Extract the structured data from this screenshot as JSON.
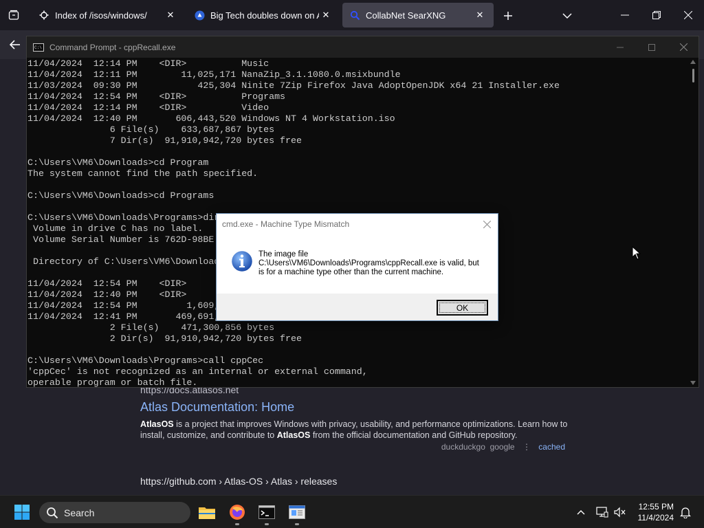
{
  "browser": {
    "tabs": [
      {
        "title": "Index of /isos/windows/",
        "active": false
      },
      {
        "title": "Big Tech doubles down on AI, S",
        "active": false
      },
      {
        "title": "CollabNet SearXNG",
        "active": true
      }
    ]
  },
  "results": [
    {
      "url": "https://docs.atlasos.net",
      "title": "Atlas Documentation: Home",
      "desc_part1_bold": "AtlasOS",
      "desc_part2": " is a project that improves Windows with privacy, usability, and performance optimizations. Learn how to install, customize, and contribute to ",
      "desc_part3_bold": "AtlasOS",
      "desc_part4": " from the official documentation and GitHub repository.",
      "engines": "duckduckgo  google",
      "sep": "⋮",
      "cached": "cached"
    },
    {
      "url": "https://github.com  › Atlas-OS › Atlas › releases"
    }
  ],
  "cmd": {
    "title": "Command Prompt - cppRecall.exe",
    "lines": [
      "11/04/2024  12:14 PM    <DIR>          Music",
      "11/04/2024  12:11 PM        11,025,171 NanaZip_3.1.1080.0.msixbundle",
      "11/03/2024  09:30 PM           425,304 Ninite 7Zip Firefox Java AdoptOpenJDK x64 21 Installer.exe",
      "11/04/2024  12:54 PM    <DIR>          Programs",
      "11/04/2024  12:14 PM    <DIR>          Video",
      "11/04/2024  12:40 PM       606,443,520 Windows NT 4 Workstation.iso",
      "               6 File(s)    633,687,867 bytes",
      "               7 Dir(s)  91,910,942,720 bytes free",
      "",
      "C:\\Users\\VM6\\Downloads>cd Program",
      "The system cannot find the path specified.",
      "",
      "C:\\Users\\VM6\\Downloads>cd Programs",
      "",
      "C:\\Users\\VM6\\Downloads\\Programs>dir",
      " Volume in drive C has no label.",
      " Volume Serial Number is 762D-98BE",
      "",
      " Directory of C:\\Users\\VM6\\Downloads\\Programs",
      "",
      "11/04/2024  12:54 PM    <DIR>          .",
      "11/04/2024  12:40 PM    <DIR>          ..",
      "11/04/2024  12:54 PM         1,609,",
      "11/04/2024  12:41 PM       469,691,",
      "               2 File(s)    471,300,856 bytes",
      "               2 Dir(s)  91,910,942,720 bytes free",
      "",
      "C:\\Users\\VM6\\Downloads\\Programs>call cppCec",
      "'cppCec' is not recognized as an internal or external command,",
      "operable program or batch file."
    ]
  },
  "dialog": {
    "title": "cmd.exe - Machine Type Mismatch",
    "line1": "The image file",
    "line2": "C:\\Users\\VM6\\Downloads\\Programs\\cppRecall.exe is valid, but",
    "line3": "is for a machine type other than the current machine.",
    "ok": "OK"
  },
  "taskbar": {
    "search_placeholder": "Search",
    "time": "12:55 PM",
    "date": "11/4/2024"
  },
  "colors": {
    "accent": "#8ab4f8",
    "cmd_bg": "#0c0c0c",
    "cmd_text": "#cccccc"
  }
}
